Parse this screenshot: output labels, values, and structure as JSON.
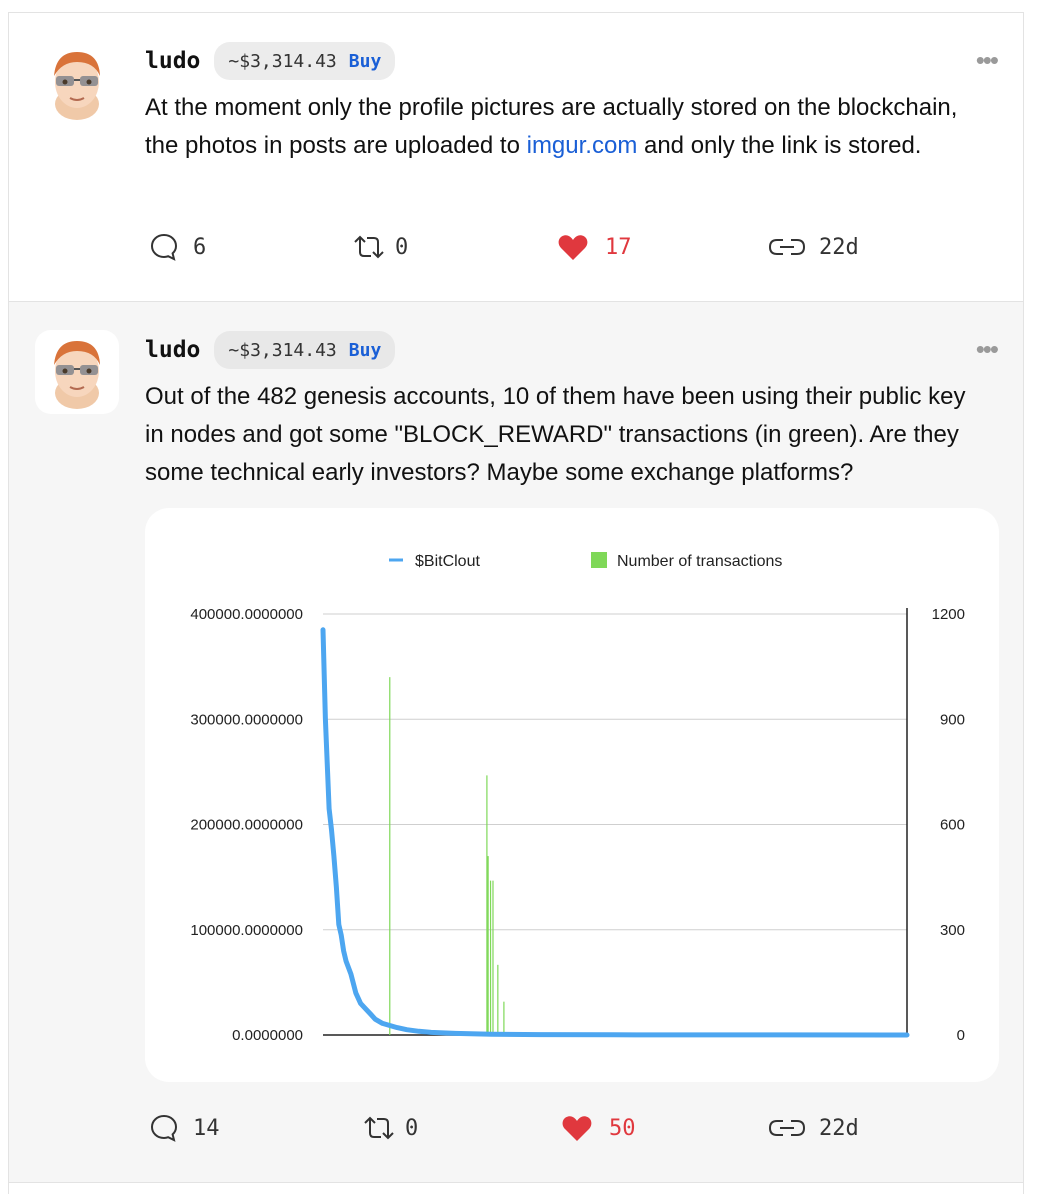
{
  "posts": [
    {
      "username": "ludo",
      "price": "~$3,314.43",
      "buy_label": "Buy",
      "more_label": "•••",
      "text_before": "At the moment only the profile pictures are actually stored on the blockchain, the photos in posts are uploaded to ",
      "link_text": "imgur.com",
      "text_after": " and only the link is stored.",
      "comments": "6",
      "reclouts": "0",
      "likes": "17",
      "age": "22d"
    },
    {
      "username": "ludo",
      "price": "~$3,314.43",
      "buy_label": "Buy",
      "more_label": "•••",
      "text": "Out of the 482 genesis accounts, 10 of them have been using their public key in nodes and got some \"BLOCK_REWARD\" transactions (in green). Are they some technical early investors? Maybe some exchange platforms?",
      "comments": "14",
      "reclouts": "0",
      "likes": "50",
      "age": "22d"
    }
  ],
  "colors": {
    "link": "#1a5fd6",
    "like": "#e0383e",
    "line_series": "#4da6f0",
    "bar_series": "#7fd858"
  },
  "icons": [
    "comment-icon",
    "reclout-icon",
    "heart-icon",
    "link-icon",
    "more-icon"
  ],
  "chart_data": {
    "type": "line",
    "legend": [
      "$BitClout",
      "Number of transactions"
    ],
    "legend_position": "top",
    "grid": true,
    "y_left": {
      "ticks": [
        "400000.0000000",
        "300000.0000000",
        "200000.0000000",
        "100000.0000000",
        "0.0000000"
      ],
      "ylim": [
        0,
        400000
      ]
    },
    "y_right": {
      "ticks": [
        "1200",
        "900",
        "600",
        "300",
        "0"
      ],
      "ylim": [
        0,
        1200
      ]
    },
    "series": [
      {
        "name": "$BitClout",
        "type": "line",
        "x": [
          1,
          3,
          6,
          8,
          10,
          12,
          14,
          16,
          18,
          20,
          24,
          28,
          32,
          36,
          40,
          44,
          50,
          56,
          62,
          70,
          80,
          90,
          110,
          140,
          180,
          240,
          300,
          380,
          482
        ],
        "y": [
          385000,
          300000,
          215000,
          195000,
          170000,
          140000,
          105000,
          95000,
          80000,
          70000,
          58000,
          40000,
          30000,
          25000,
          20000,
          15000,
          11000,
          9000,
          7000,
          5000,
          3500,
          2500,
          1500,
          800,
          400,
          200,
          100,
          50,
          0
        ]
      },
      {
        "name": "Number of transactions",
        "type": "bar",
        "x": [
          56,
          136,
          137,
          139,
          141,
          145,
          150
        ],
        "y": [
          1020,
          740,
          510,
          440,
          440,
          200,
          95
        ]
      }
    ]
  }
}
